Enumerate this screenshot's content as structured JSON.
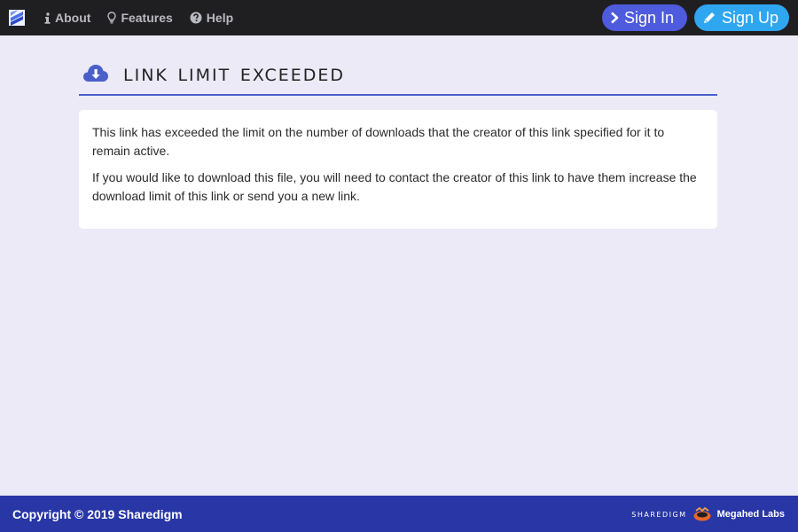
{
  "navbar": {
    "brand_icon": "sharedigm-logo-icon",
    "links": [
      {
        "label": "About",
        "icon": "info-icon"
      },
      {
        "label": "Features",
        "icon": "lightbulb-icon"
      },
      {
        "label": "Help",
        "icon": "question-circle-icon"
      }
    ],
    "sign_in_label": "Sign In",
    "sign_up_label": "Sign Up",
    "colors": {
      "bar": "#1f1f22",
      "sign_in": "#4e5bdd",
      "sign_up": "#2fa6f0"
    }
  },
  "main": {
    "title": "Link Limit Exceeded",
    "title_icon": "cloud-download-icon",
    "paragraphs": [
      "This link has exceeded the limit on the number of downloads that the creator of this link specified for it to remain active.",
      "If you would like to download this file, you will need to contact the creator of this link to have them increase the download limit of this link or send you a new link."
    ]
  },
  "footer": {
    "copyright": "Copyright © 2019 Sharedigm",
    "brand_wordmark": "Sharedigm",
    "partner_label": "Megahed Labs",
    "partner_icon": "megahed-labs-logo",
    "color": "#2836a6"
  }
}
